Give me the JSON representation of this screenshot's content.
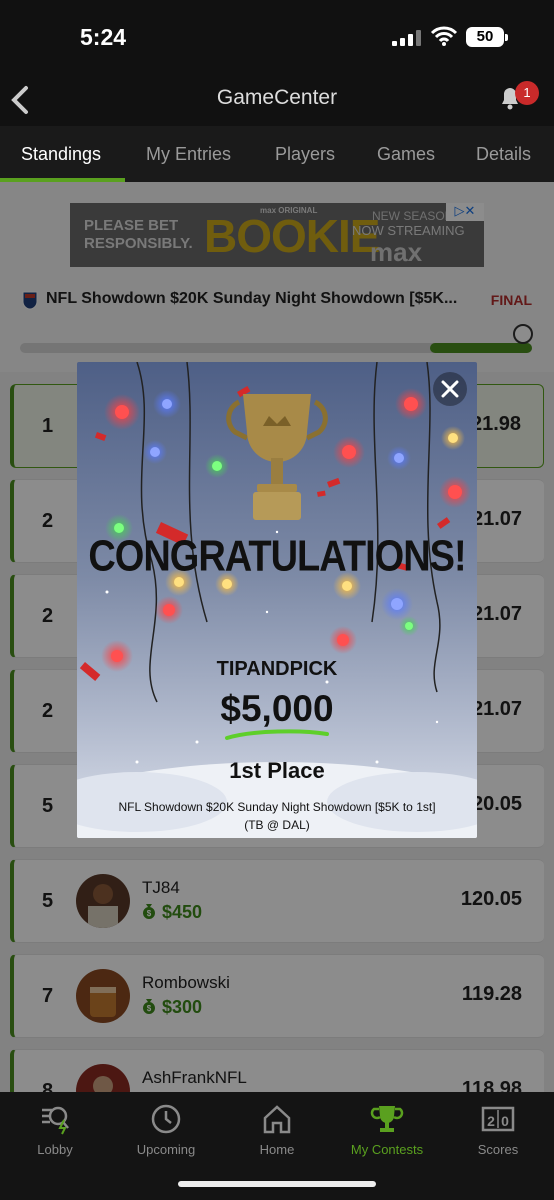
{
  "status_bar": {
    "time": "5:24",
    "battery": "50"
  },
  "header": {
    "title": "GameCenter",
    "notification_count": "1"
  },
  "tabs": [
    {
      "label": "Standings",
      "active": true
    },
    {
      "label": "My Entries"
    },
    {
      "label": "Players"
    },
    {
      "label": "Games"
    },
    {
      "label": "Details"
    }
  ],
  "ad": {
    "left_text_1": "PLEASE BET",
    "left_text_2": "RESPONSIBLY.",
    "small": "max ORIGINAL",
    "headline": "BOOKIE",
    "right_1": "NEW SEASON",
    "right_2": "NOW STREAMING",
    "brand": "max"
  },
  "contest": {
    "name": "NFL Showdown $20K Sunday Night Showdown [$5K...",
    "status": "FINAL",
    "progress": 0.8
  },
  "standings": [
    {
      "rank": "1",
      "score": "121.98"
    },
    {
      "rank": "2",
      "score": "121.07"
    },
    {
      "rank": "2",
      "score": "121.07"
    },
    {
      "rank": "2",
      "score": "121.07"
    },
    {
      "rank": "5",
      "score": "120.05"
    },
    {
      "rank": "5",
      "username": "TJ84",
      "prize": "$450",
      "score": "120.05"
    },
    {
      "rank": "7",
      "username": "Rombowski",
      "prize": "$300",
      "score": "119.28"
    },
    {
      "rank": "8",
      "username": "AshFrankNFL",
      "score": "118.98"
    }
  ],
  "modal": {
    "title": "CONGRATULATIONS!",
    "winner": "TIPANDPICK",
    "amount": "$5,000",
    "place": "1st Place",
    "contest_line_1": "NFL Showdown $20K Sunday Night Showdown [$5K to 1st]",
    "contest_line_2": "(TB @ DAL)"
  },
  "bottom_nav": [
    {
      "label": "Lobby",
      "icon": "lobby-icon"
    },
    {
      "label": "Upcoming",
      "icon": "clock-icon"
    },
    {
      "label": "Home",
      "icon": "home-icon"
    },
    {
      "label": "My Contests",
      "icon": "trophy-icon",
      "active": true
    },
    {
      "label": "Scores",
      "icon": "scoreboard-icon"
    }
  ],
  "colors": {
    "accent": "#5aa01f",
    "final": "#b32d2d",
    "prize": "#3e8a1c"
  }
}
